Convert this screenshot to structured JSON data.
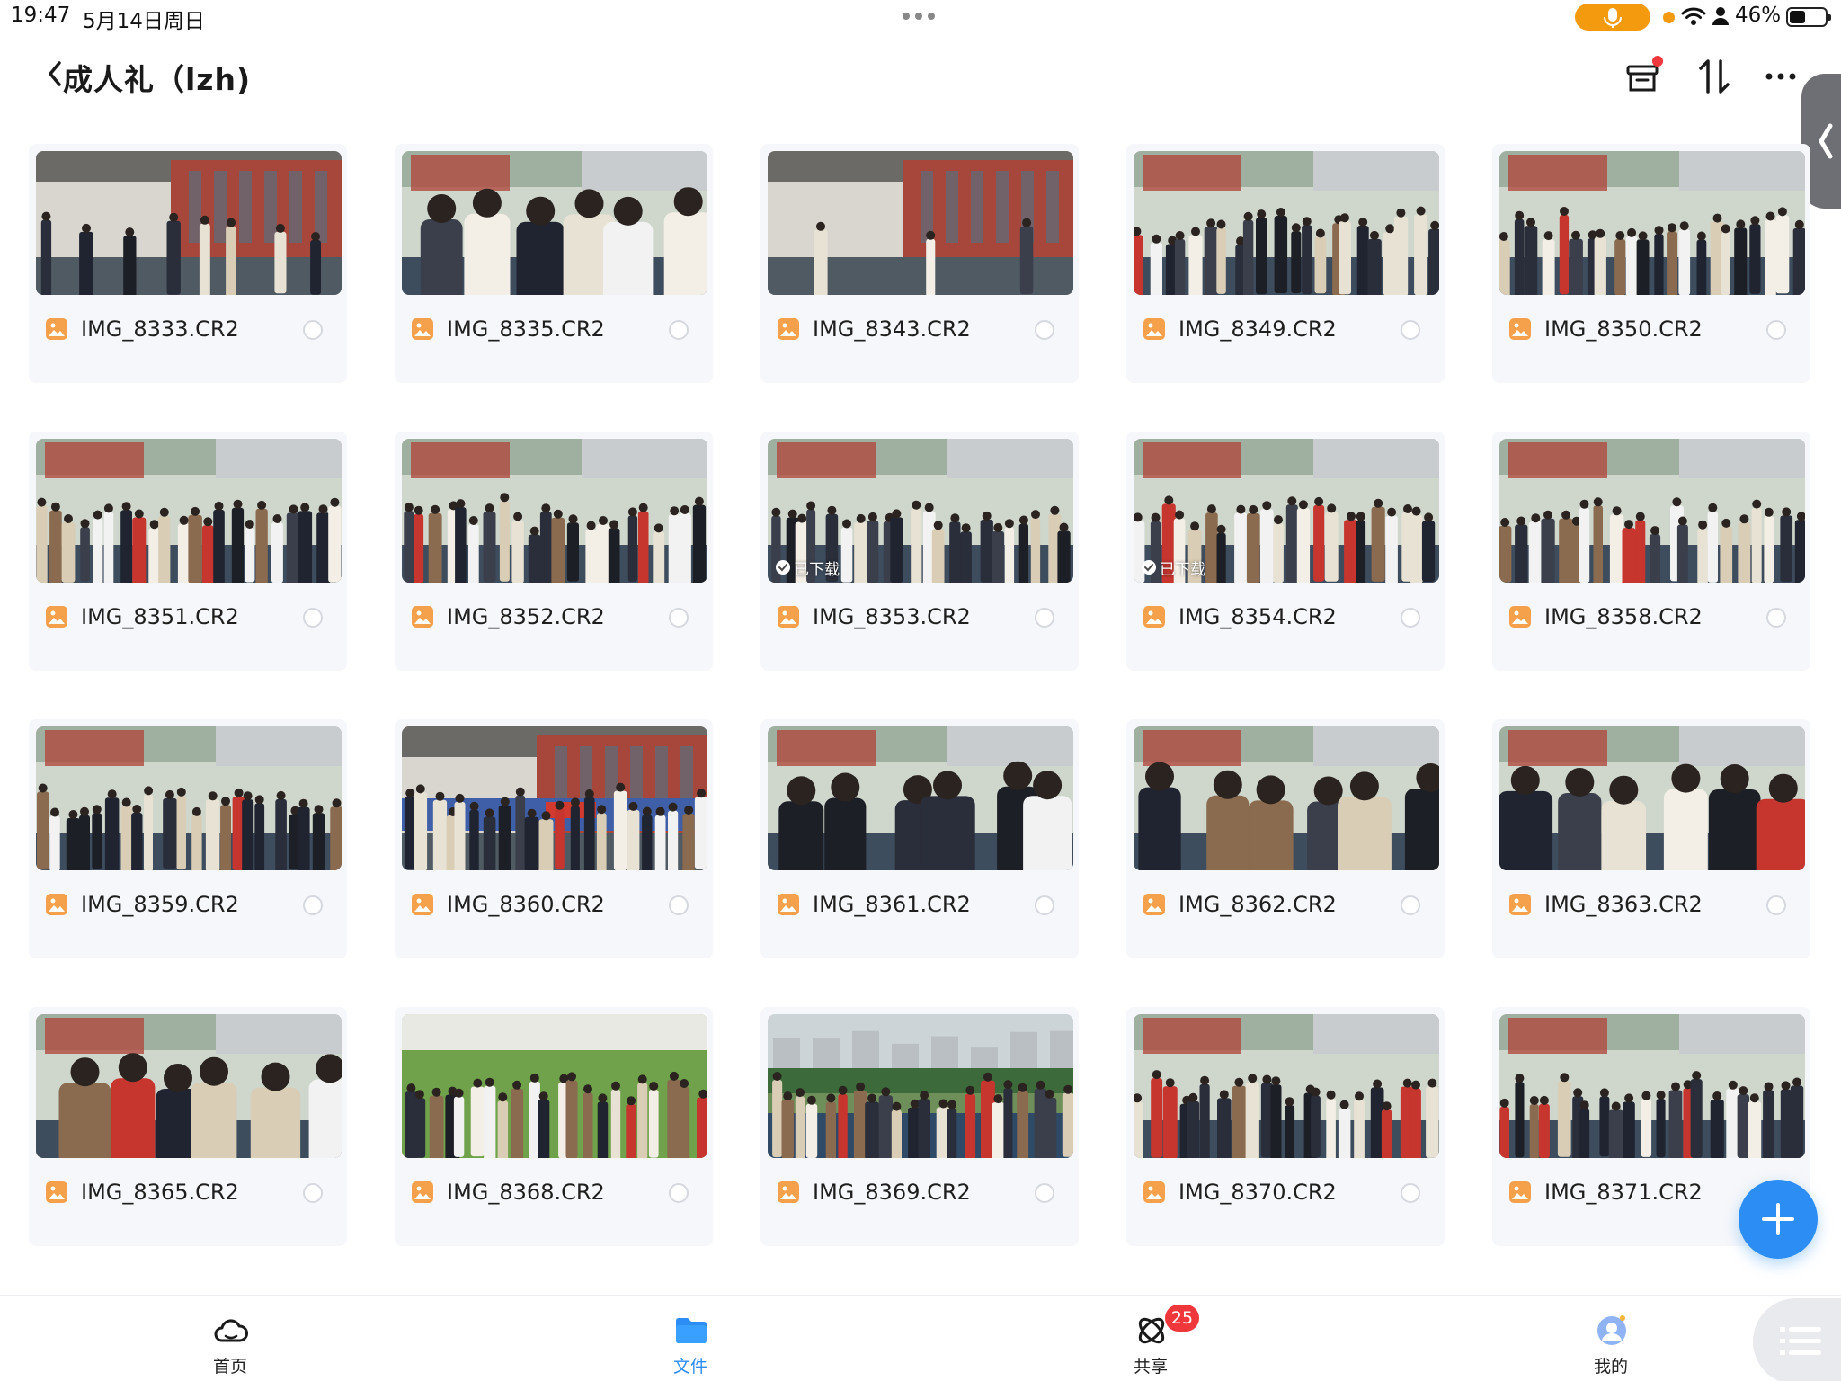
{
  "status_bar": {
    "time": "19:47",
    "date": "5月14日周日",
    "battery": "46%",
    "battery_level": 0.46
  },
  "header": {
    "title": "成人礼（lzh)",
    "has_notification_dot": true
  },
  "files": [
    {
      "name": "IMG_8333.CR2",
      "downloaded": false,
      "scene": "stage"
    },
    {
      "name": "IMG_8335.CR2",
      "downloaded": false,
      "scene": "closeup"
    },
    {
      "name": "IMG_8343.CR2",
      "downloaded": false,
      "scene": "speaker"
    },
    {
      "name": "IMG_8349.CR2",
      "downloaded": false,
      "scene": "crowd"
    },
    {
      "name": "IMG_8350.CR2",
      "downloaded": false,
      "scene": "crowd"
    },
    {
      "name": "IMG_8351.CR2",
      "downloaded": false,
      "scene": "crowd"
    },
    {
      "name": "IMG_8352.CR2",
      "downloaded": false,
      "scene": "crowd"
    },
    {
      "name": "IMG_8353.CR2",
      "downloaded": true,
      "badge": "已下载",
      "scene": "crowd"
    },
    {
      "name": "IMG_8354.CR2",
      "downloaded": true,
      "badge": "已下载",
      "scene": "crowd"
    },
    {
      "name": "IMG_8358.CR2",
      "downloaded": false,
      "scene": "crowd"
    },
    {
      "name": "IMG_8359.CR2",
      "downloaded": false,
      "scene": "crowd"
    },
    {
      "name": "IMG_8360.CR2",
      "downloaded": false,
      "scene": "building"
    },
    {
      "name": "IMG_8361.CR2",
      "downloaded": false,
      "scene": "closeup"
    },
    {
      "name": "IMG_8362.CR2",
      "downloaded": false,
      "scene": "closeup"
    },
    {
      "name": "IMG_8363.CR2",
      "downloaded": false,
      "scene": "closeup"
    },
    {
      "name": "IMG_8365.CR2",
      "downloaded": false,
      "scene": "closeup"
    },
    {
      "name": "IMG_8368.CR2",
      "downloaded": false,
      "scene": "grass"
    },
    {
      "name": "IMG_8369.CR2",
      "downloaded": false,
      "scene": "field"
    },
    {
      "name": "IMG_8370.CR2",
      "downloaded": false,
      "scene": "crowd"
    },
    {
      "name": "IMG_8371.CR2",
      "downloaded": false,
      "scene": "crowd"
    }
  ],
  "tabbar": {
    "tabs": [
      {
        "label": "首页",
        "icon": "cloud-icon",
        "active": false
      },
      {
        "label": "文件",
        "icon": "folder-icon",
        "active": true
      },
      {
        "label": "共享",
        "icon": "share-icon",
        "active": false,
        "badge": "25"
      },
      {
        "label": "我的",
        "icon": "profile-icon",
        "active": false
      }
    ]
  },
  "colors": {
    "accent": "#2c8ef5",
    "file_icon": "#f5a04a",
    "badge": "#f0373b",
    "mic": "#f39a0f"
  }
}
